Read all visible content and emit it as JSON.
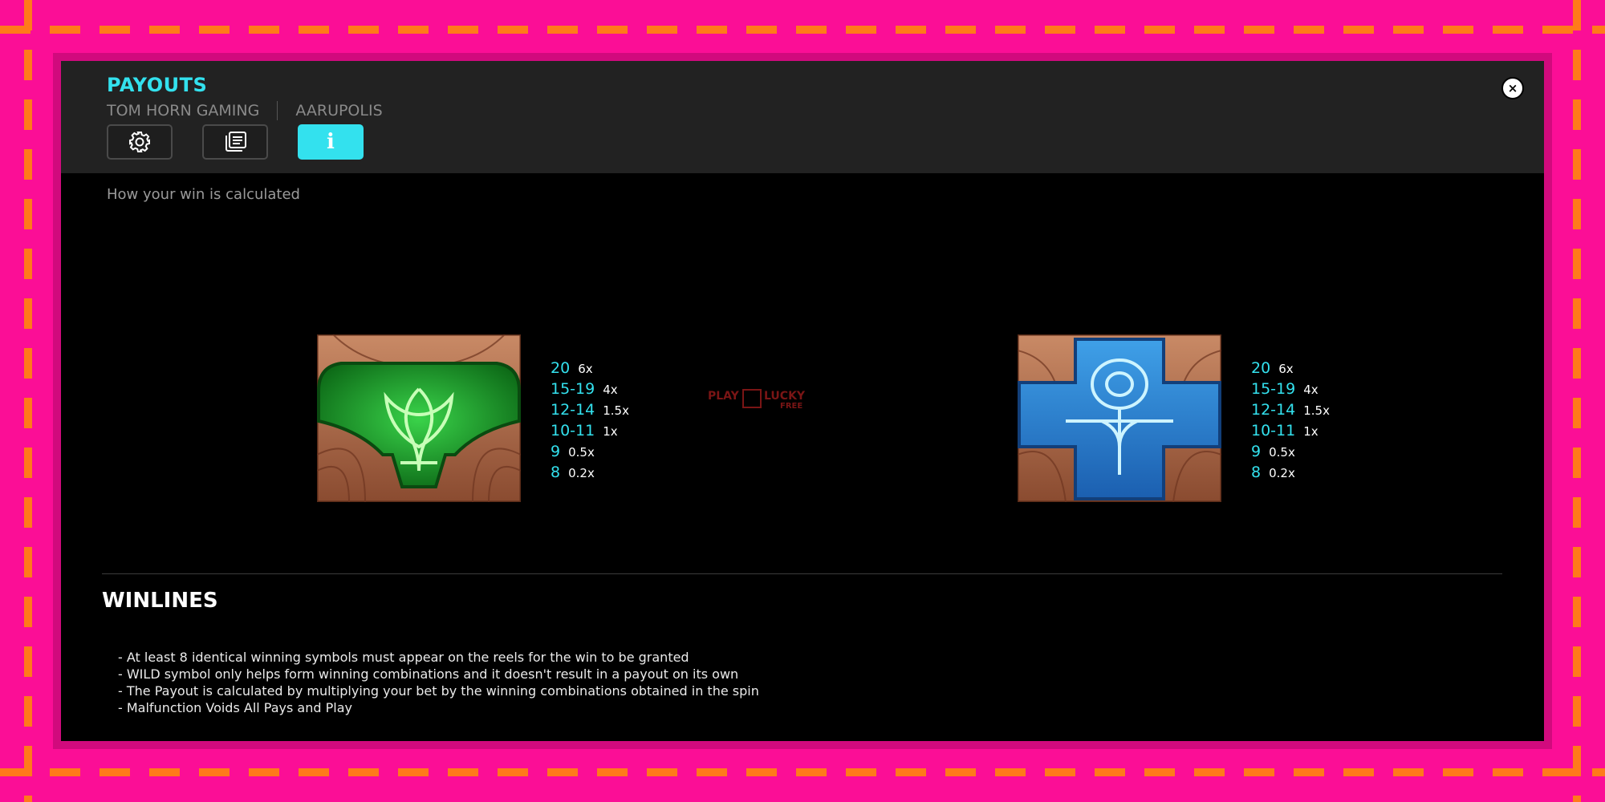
{
  "header": {
    "title": "PAYOUTS",
    "provider": "TOM HORN GAMING",
    "game": "AARUPOLIS",
    "tabs": [
      {
        "icon": "gear-icon",
        "active": false
      },
      {
        "icon": "paytable-icon",
        "active": false
      },
      {
        "icon": "info-icon",
        "label": "i",
        "active": true
      }
    ],
    "close_label": "×"
  },
  "intro_text": "How your win is calculated",
  "symbols": [
    {
      "icon": "green-lotus-symbol",
      "payouts": [
        {
          "range": "20",
          "mult": "6x"
        },
        {
          "range": "15-19",
          "mult": "4x"
        },
        {
          "range": "12-14",
          "mult": "1.5x"
        },
        {
          "range": "10-11",
          "mult": "1x"
        },
        {
          "range": "9",
          "mult": "0.5x"
        },
        {
          "range": "8",
          "mult": "0.2x"
        }
      ]
    },
    {
      "icon": "blue-ankh-symbol",
      "payouts": [
        {
          "range": "20",
          "mult": "6x"
        },
        {
          "range": "15-19",
          "mult": "4x"
        },
        {
          "range": "12-14",
          "mult": "1.5x"
        },
        {
          "range": "10-11",
          "mult": "1x"
        },
        {
          "range": "9",
          "mult": "0.5x"
        },
        {
          "range": "8",
          "mult": "0.2x"
        }
      ]
    }
  ],
  "watermark": {
    "play": "PLAY",
    "lucky": "LUCKY",
    "free": "FREE"
  },
  "winlines": {
    "title": "WINLINES",
    "rules": [
      "- At least 8 identical winning symbols must appear on the reels for the win to be granted",
      "- WILD symbol only helps form winning combinations and it doesn't result in a payout on its own",
      "- The Payout is calculated by multiplying your bet by the winning combinations obtained in the spin",
      "- Malfunction Voids All Pays and Play"
    ]
  },
  "colors": {
    "frame": "#fb0e96",
    "dash": "#ff7a1a",
    "accent": "#33e1ee",
    "header_bg": "#222222",
    "panel_bg": "#000000"
  }
}
